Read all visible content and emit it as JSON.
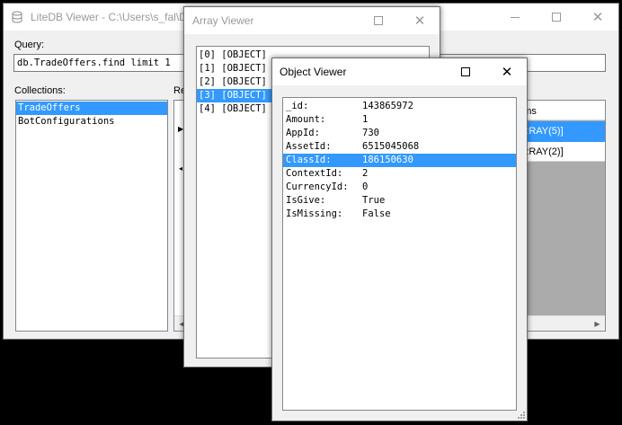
{
  "main_window": {
    "title": "LiteDB Viewer - C:\\Users\\s_fal\\De",
    "query_label": "Query:",
    "query_value": "db.TradeOffers.find limit 1",
    "collections_label": "Collections:",
    "collections": [
      {
        "label": "TradeOffers",
        "selected": true
      },
      {
        "label": "BotConfigurations",
        "selected": false
      }
    ],
    "result_label": "Re",
    "grid_header": "Items",
    "grid_rows": [
      "[ARRAY(5)]",
      "[ARRAY(2)]"
    ],
    "row_marker": "▶"
  },
  "array_window": {
    "title": "Array Viewer",
    "items": [
      {
        "label": "[0] [OBJECT]",
        "selected": false
      },
      {
        "label": "[1] [OBJECT]",
        "selected": false
      },
      {
        "label": "[2] [OBJECT]",
        "selected": false
      },
      {
        "label": "[3] [OBJECT]",
        "selected": true
      },
      {
        "label": "[4] [OBJECT]",
        "selected": false
      }
    ]
  },
  "object_window": {
    "title": "Object Viewer",
    "fields": [
      {
        "key": "_id:",
        "value": "143865972",
        "selected": false
      },
      {
        "key": "Amount:",
        "value": "1",
        "selected": false
      },
      {
        "key": "AppId:",
        "value": "730",
        "selected": false
      },
      {
        "key": "AssetId:",
        "value": "6515045068",
        "selected": false
      },
      {
        "key": "ClassId:",
        "value": "186150630",
        "selected": true
      },
      {
        "key": "ContextId:",
        "value": "2",
        "selected": false
      },
      {
        "key": "CurrencyId:",
        "value": "0",
        "selected": false
      },
      {
        "key": "IsGive:",
        "value": "True",
        "selected": false
      },
      {
        "key": "IsMissing:",
        "value": "False",
        "selected": false
      }
    ]
  },
  "colors": {
    "selection": "#3399ff",
    "grid_empty": "#ababab"
  },
  "icons": {
    "app": "database-icon",
    "minimize": "minimize-icon",
    "maximize": "maximize-icon",
    "close": "close-icon"
  }
}
